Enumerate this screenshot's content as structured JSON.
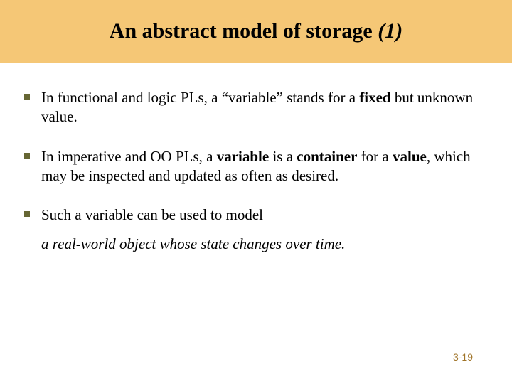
{
  "title": {
    "main": "An abstract model of storage ",
    "suffix": "(1)"
  },
  "bullets": {
    "b1": {
      "pre": "In functional and logic PLs, a “variable” stands for a ",
      "bold1": "fixed",
      "post": " but unknown value."
    },
    "b2": {
      "pre": "In imperative and OO PLs, a ",
      "bold1": "variable",
      "mid1": " is a ",
      "bold2": "container",
      "mid2": " for a ",
      "bold3": "value",
      "post": ", which may be inspected and updated as often as desired."
    },
    "b3": {
      "text": "Such a variable can be used to model"
    },
    "subline": "a real-world object whose state changes over time."
  },
  "page_number": "3-19"
}
